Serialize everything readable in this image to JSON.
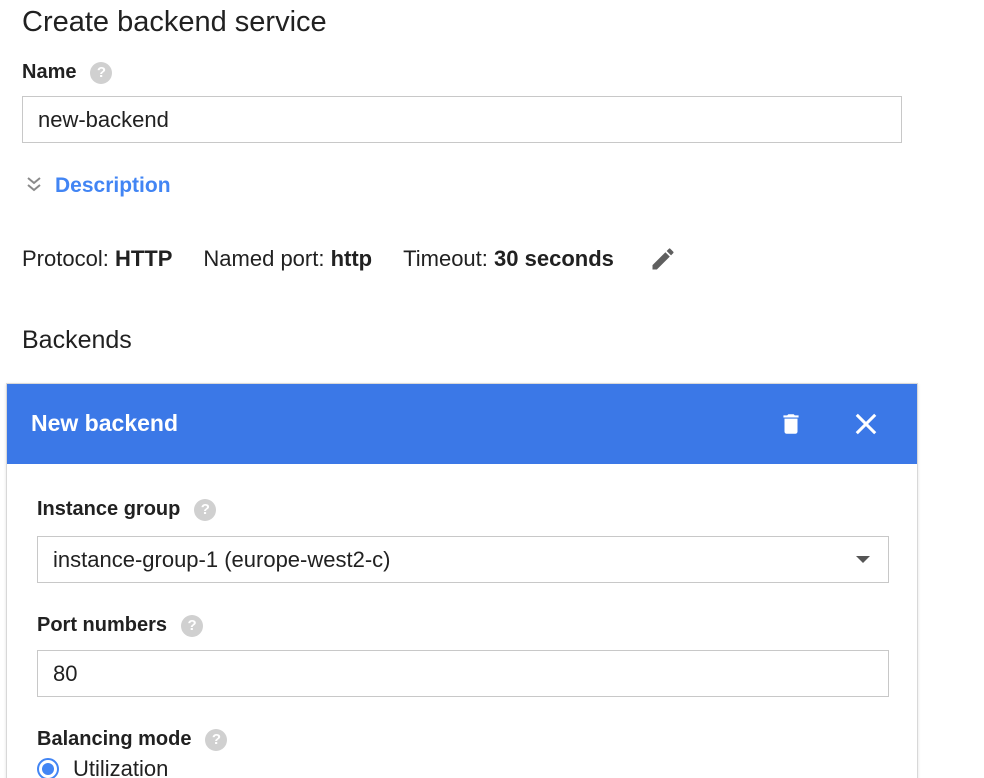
{
  "page": {
    "title": "Create backend service"
  },
  "name_field": {
    "label": "Name",
    "help_icon": "help-circle-icon",
    "value": "new-backend"
  },
  "description": {
    "toggle_label": "Description",
    "icon": "expand-chevron-icon"
  },
  "protocol_row": {
    "protocol_label": "Protocol:",
    "protocol_value": "HTTP",
    "named_port_label": "Named port:",
    "named_port_value": "http",
    "timeout_label": "Timeout:",
    "timeout_value": "30 seconds",
    "edit_icon": "pencil-icon"
  },
  "backends": {
    "section_title": "Backends",
    "card": {
      "title": "New backend",
      "delete_icon": "trash-icon",
      "close_icon": "close-icon",
      "header_color": "#3b78e7",
      "instance_group": {
        "label": "Instance group",
        "selected": "instance-group-1 (europe-west2-c)"
      },
      "port_numbers": {
        "label": "Port numbers",
        "value": "80"
      },
      "balancing_mode": {
        "label": "Balancing mode",
        "options": [
          {
            "label": "Utilization",
            "selected": true
          }
        ]
      }
    }
  },
  "colors": {
    "accent": "#4285f4",
    "text": "#212121",
    "border": "#c8c8c8"
  }
}
